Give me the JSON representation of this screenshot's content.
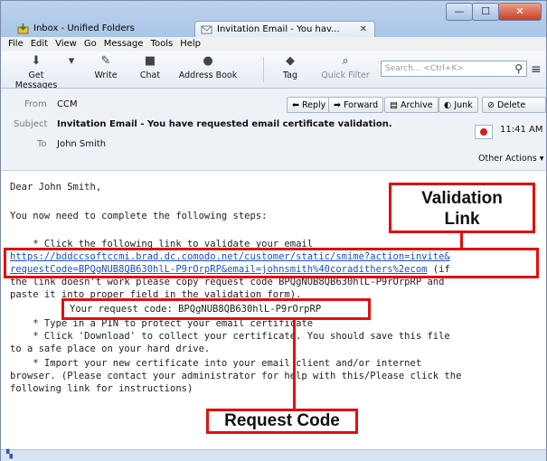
{
  "window": {
    "tabs": [
      {
        "label": "Inbox - Unified Folders"
      },
      {
        "label": "Invitation Email - You hav...",
        "close": "✕"
      }
    ],
    "controls": {
      "minimize": "—",
      "maximize": "☐",
      "close": "✕"
    }
  },
  "menu": [
    "File",
    "Edit",
    "View",
    "Go",
    "Message",
    "Tools",
    "Help"
  ],
  "toolbar": {
    "buttons": [
      "Get Messages",
      "Write",
      "Chat",
      "Address Book",
      "Tag",
      "Quick Filter"
    ],
    "search_placeholder": "Search... <Ctrl+K>"
  },
  "header": {
    "from_label": "From",
    "from_value": "CCM",
    "subject_label": "Subject",
    "subject_value": "Invitation Email - You have requested email certificate validation.",
    "to_label": "To",
    "to_value": "John Smith",
    "time": "11:41 AM",
    "other_actions": "Other Actions",
    "buttons": {
      "reply": "Reply",
      "forward": "Forward",
      "archive": "Archive",
      "junk": "Junk",
      "delete": "Delete"
    }
  },
  "body": {
    "greeting": "Dear John Smith,",
    "intro": "You now need to complete the following steps:",
    "step1": "    * Click the following link to validate your email",
    "link_line1": "https://bddccsoftccmi.brad.dc.comodo.net/customer/static/smime?action=invite&",
    "link_line2": "requestCode=BPQgNUB8QB630hlL-P9rOrpRP&email=johnsmith%40coradithers%2ecom",
    "link_after": " (if",
    "line_copy1": "the link doesn't work please copy request code BPQgNUB8QB630hlL-P9rOrpRP and",
    "line_copy2": "paste it into proper field in the validation form).",
    "request_code": "Your request code: BPQgNUB8QB630hlL-P9rOrpRP",
    "step_pin": "    * Type in a PIN to protect your email certificate",
    "step_download": "    * Click 'Download' to collect your certificate. You should save this file",
    "step_download2": "to a safe place on your hard drive.",
    "step_import": "    * Import your new certificate into your email client and/or internet",
    "step_import2": "browser. (Please contact your administrator for help with this/Please click the",
    "step_import3": "following link for instructions)"
  },
  "callouts": {
    "validation_line1": "Validation",
    "validation_line2": "Link",
    "request_code": "Request Code"
  },
  "colors": {
    "highlight": "#e01010",
    "link": "#1a51c9"
  }
}
